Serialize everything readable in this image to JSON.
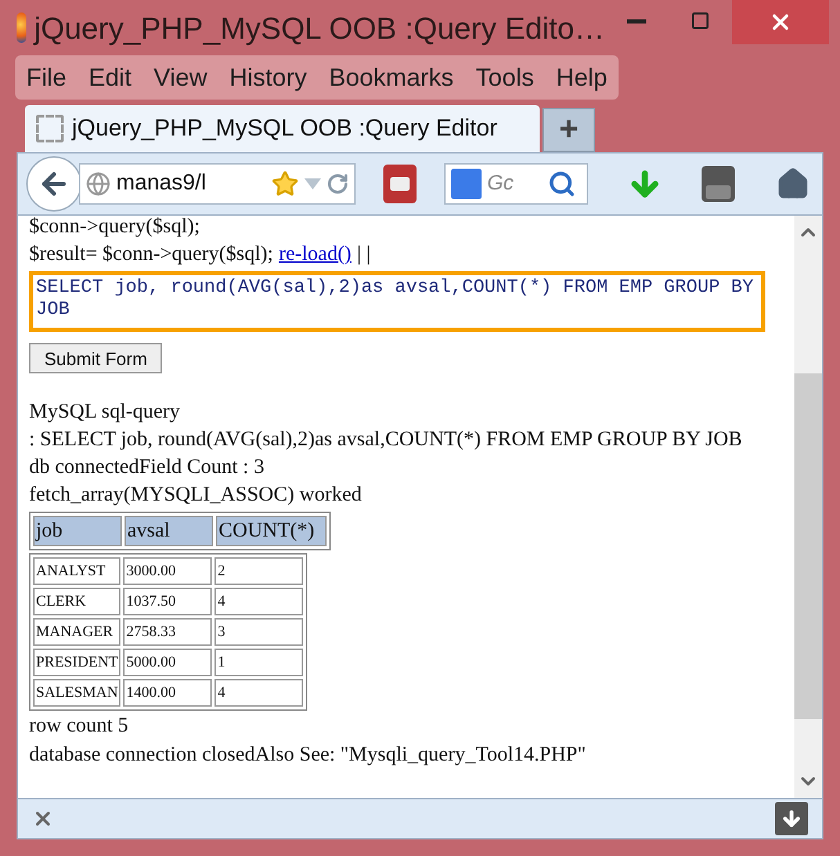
{
  "window": {
    "title": "jQuery_PHP_MySQL OOB :Query Edito…"
  },
  "menu": [
    "File",
    "Edit",
    "View",
    "History",
    "Bookmarks",
    "Tools",
    "Help"
  ],
  "tabs": [
    {
      "label": "jQuery_PHP_MySQL OOB :Query Editor",
      "selected": true
    }
  ],
  "new_tab": "+",
  "toolbar": {
    "url": "manas9/l",
    "search": {
      "placeholder": "Gc"
    }
  },
  "page": {
    "code_line": "$conn->query($sql);",
    "result_line": "$result= $conn->query($sql);",
    "link": "re-load()",
    "separator": "| |",
    "query": "SELECT job, round(AVG(sal),2)as avsal,COUNT(*) FROM EMP GROUP BY JOB",
    "submit": "Submit Form",
    "output": [
      "MySQL sql-query",
      ": SELECT job, round(AVG(sal),2)as avsal,COUNT(*) FROM EMP GROUP BY JOB",
      "db connectedField Count : 3",
      "fetch_array(MYSQLI_ASSOC) worked"
    ],
    "table": {
      "columns": [
        "job",
        "avsal",
        "COUNT(*)"
      ],
      "rows": [
        [
          "ANALYST",
          "3000.00",
          "2"
        ],
        [
          "CLERK",
          "1037.50",
          "4"
        ],
        [
          "MANAGER",
          "2758.33",
          "3"
        ],
        [
          "PRESIDENT",
          "5000.00",
          "1"
        ],
        [
          "SALESMAN",
          "1400.00",
          "4"
        ]
      ]
    },
    "footer": [
      "row count 5",
      "database connection closedAlso See: \"Mysqli_query_Tool14.PHP\""
    ]
  }
}
